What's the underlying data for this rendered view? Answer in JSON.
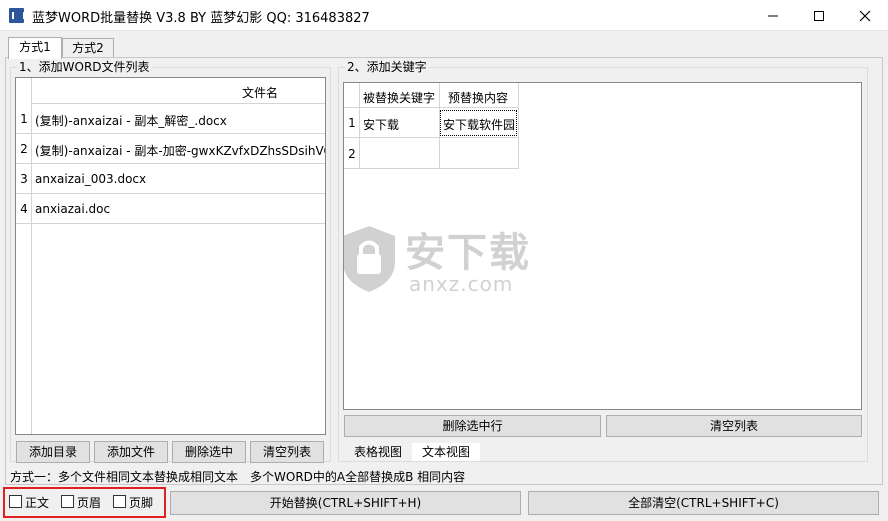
{
  "window": {
    "title": "蓝梦WORD批量替换 V3.8 BY 蓝梦幻影 QQ: 316483827",
    "minimize_icon": "minimize-icon",
    "maximize_icon": "maximize-icon",
    "close_icon": "close-icon"
  },
  "tabs": [
    {
      "label": "方式1",
      "active": true
    },
    {
      "label": "方式2",
      "active": false
    }
  ],
  "file_section": {
    "title": "1、添加WORD文件列表",
    "column_header": "文件名",
    "rows": [
      {
        "index": "1",
        "name": "(复制)-anxaizai - 副本_解密_.docx"
      },
      {
        "index": "2",
        "name": "(复制)-anxaizai - 副本-加密-gwxKZvfxDZhsSDsihVOl"
      },
      {
        "index": "3",
        "name": "anxaizai_003.docx"
      },
      {
        "index": "4",
        "name": "anxiazai.doc"
      }
    ],
    "buttons": {
      "add_dir": "添加目录",
      "add_file": "添加文件",
      "delete_selected": "删除选中",
      "clear_list": "清空列表"
    }
  },
  "keyword_section": {
    "title": "2、添加关键字",
    "headers": [
      "被替换关键字",
      "预替换内容"
    ],
    "rows": [
      {
        "index": "1",
        "find": "安下载",
        "replace": "安下载软件园"
      },
      {
        "index": "2",
        "find": "",
        "replace": ""
      }
    ],
    "buttons": {
      "delete_row": "删除选中行",
      "clear_list": "清空列表"
    },
    "view_tabs": [
      "表格视图",
      "文本视图"
    ]
  },
  "description": "方式一：多个文件相同文本替换成相同文本　多个WORD中的A全部替换成B 相同内容",
  "bottom": {
    "options": [
      {
        "label": "正文",
        "checked": false
      },
      {
        "label": "页眉",
        "checked": false
      },
      {
        "label": "页脚",
        "checked": false
      }
    ],
    "start_button": "开始替换(CTRL+SHIFT+H)",
    "clear_all_button": "全部清空(CTRL+SHIFT+C)"
  },
  "watermark": {
    "text_cn": "安下载",
    "text_en": "anxz.com"
  },
  "colors": {
    "accent_border": "#e02020",
    "grid_line": "#d4d4d4",
    "button_face": "#e1e1e1"
  }
}
